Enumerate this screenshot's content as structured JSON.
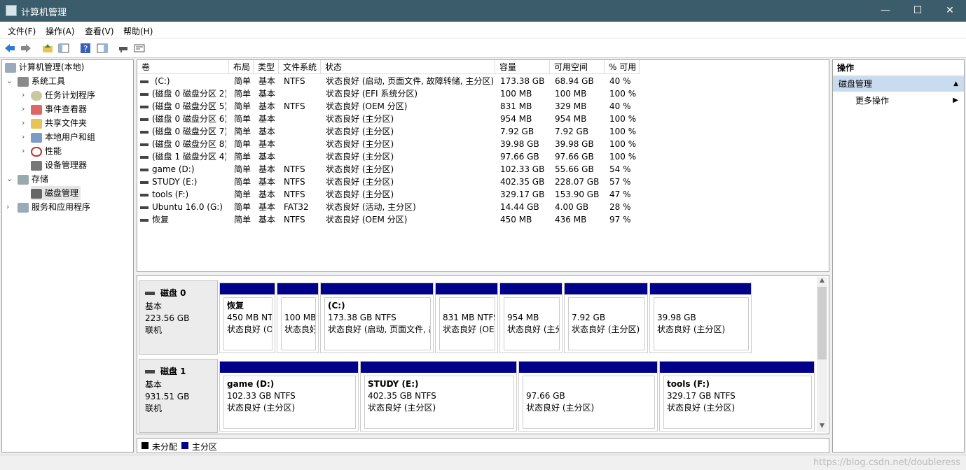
{
  "window": {
    "title": "计算机管理",
    "min": "—",
    "max": "☐",
    "close": "✕"
  },
  "menu": [
    "文件(F)",
    "操作(A)",
    "查看(V)",
    "帮助(H)"
  ],
  "tree": {
    "root": "计算机管理(本地)",
    "system_tools": "系统工具",
    "task_scheduler": "任务计划程序",
    "event_viewer": "事件查看器",
    "shared_folders": "共享文件夹",
    "local_users": "本地用户和组",
    "performance": "性能",
    "device_manager": "设备管理器",
    "storage": "存储",
    "disk_management": "磁盘管理",
    "services": "服务和应用程序"
  },
  "volume_table": {
    "headers": [
      "卷",
      "布局",
      "类型",
      "文件系统",
      "状态",
      "容量",
      "可用空间",
      "% 可用"
    ],
    "rows": [
      [
        " (C:)",
        "简单",
        "基本",
        "NTFS",
        "状态良好 (启动, 页面文件, 故障转储, 主分区)",
        "173.38 GB",
        "68.94 GB",
        "40 %"
      ],
      [
        "(磁盘 0 磁盘分区 2)",
        "简单",
        "基本",
        "",
        "状态良好 (EFI 系统分区)",
        "100 MB",
        "100 MB",
        "100 %"
      ],
      [
        "(磁盘 0 磁盘分区 5)",
        "简单",
        "基本",
        "NTFS",
        "状态良好 (OEM 分区)",
        "831 MB",
        "329 MB",
        "40 %"
      ],
      [
        "(磁盘 0 磁盘分区 6)",
        "简单",
        "基本",
        "",
        "状态良好 (主分区)",
        "954 MB",
        "954 MB",
        "100 %"
      ],
      [
        "(磁盘 0 磁盘分区 7)",
        "简单",
        "基本",
        "",
        "状态良好 (主分区)",
        "7.92 GB",
        "7.92 GB",
        "100 %"
      ],
      [
        "(磁盘 0 磁盘分区 8)",
        "简单",
        "基本",
        "",
        "状态良好 (主分区)",
        "39.98 GB",
        "39.98 GB",
        "100 %"
      ],
      [
        "(磁盘 1 磁盘分区 4)",
        "简单",
        "基本",
        "",
        "状态良好 (主分区)",
        "97.66 GB",
        "97.66 GB",
        "100 %"
      ],
      [
        "game (D:)",
        "简单",
        "基本",
        "NTFS",
        "状态良好 (主分区)",
        "102.33 GB",
        "55.66 GB",
        "54 %"
      ],
      [
        "STUDY (E:)",
        "简单",
        "基本",
        "NTFS",
        "状态良好 (主分区)",
        "402.35 GB",
        "228.07 GB",
        "57 %"
      ],
      [
        "tools (F:)",
        "简单",
        "基本",
        "NTFS",
        "状态良好 (主分区)",
        "329.17 GB",
        "153.90 GB",
        "47 %"
      ],
      [
        "Ubuntu 16.0 (G:)",
        "简单",
        "基本",
        "FAT32",
        "状态良好 (活动, 主分区)",
        "14.44 GB",
        "4.00 GB",
        "28 %"
      ],
      [
        "恢复",
        "简单",
        "基本",
        "NTFS",
        "状态良好 (OEM 分区)",
        "450 MB",
        "436 MB",
        "97 %"
      ]
    ]
  },
  "disks": [
    {
      "name": "磁盘 0",
      "type": "基本",
      "size": "223.56 GB",
      "status": "联机",
      "partitions": [
        {
          "title": "恢复",
          "line1": "450 MB NT",
          "line2": "状态良好 (O"
        },
        {
          "title": "",
          "line1": "100 MB",
          "line2": "状态良好"
        },
        {
          "title": " (C:)",
          "line1": "173.38 GB NTFS",
          "line2": "状态良好 (启动, 页面文件, 故"
        },
        {
          "title": "",
          "line1": "831 MB NTFS",
          "line2": "状态良好 (OEI"
        },
        {
          "title": "",
          "line1": "954 MB",
          "line2": "状态良好 (主分"
        },
        {
          "title": "",
          "line1": "7.92 GB",
          "line2": "状态良好 (主分区)"
        },
        {
          "title": "",
          "line1": "39.98 GB",
          "line2": "状态良好 (主分区)"
        }
      ]
    },
    {
      "name": "磁盘 1",
      "type": "基本",
      "size": "931.51 GB",
      "status": "联机",
      "partitions": [
        {
          "title": "game  (D:)",
          "line1": "102.33 GB NTFS",
          "line2": "状态良好 (主分区)"
        },
        {
          "title": "STUDY  (E:)",
          "line1": "402.35 GB NTFS",
          "line2": "状态良好 (主分区)"
        },
        {
          "title": "",
          "line1": "97.66 GB",
          "line2": "状态良好 (主分区)"
        },
        {
          "title": "tools  (F:)",
          "line1": "329.17 GB NTFS",
          "line2": "状态良好 (主分区)"
        }
      ]
    }
  ],
  "legend": {
    "unallocated": "未分配",
    "primary": "主分区",
    "unallocated_color": "#000000",
    "primary_color": "#00008b"
  },
  "actions": {
    "header": "操作",
    "section": "磁盘管理",
    "more": "更多操作"
  },
  "watermark": "https://blog.csdn.net/doubleress"
}
